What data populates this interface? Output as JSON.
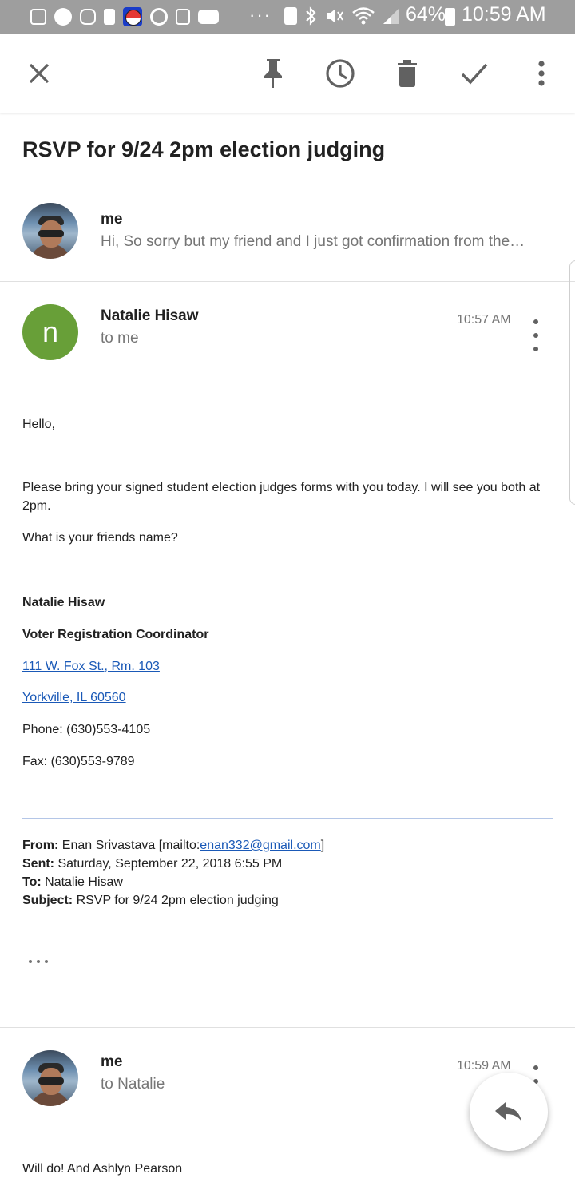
{
  "status_bar": {
    "battery": "64%",
    "time": "10:59 AM",
    "icons": [
      "messages-icon",
      "chat-bubble-icon",
      "instagram-icon",
      "lock-icon",
      "pokemon-go-icon",
      "threads-icon",
      "sim-icon",
      "youtube-icon",
      "more-notifications-icon",
      "recycle-icon",
      "bluetooth-icon",
      "mute-icon",
      "wifi-icon",
      "signal-icon",
      "battery-icon"
    ],
    "more": "···"
  },
  "toolbar": {
    "close_icon": "close-icon",
    "pin_icon": "pin-icon",
    "snooze_icon": "clock-icon",
    "delete_icon": "trash-icon",
    "done_icon": "check-icon",
    "more_icon": "more-vert-icon"
  },
  "thread": {
    "subject": "RSVP for 9/24 2pm election judging",
    "collapsed_message": {
      "sender": "me",
      "snippet": "Hi, So sorry but my friend and I just got confirmation from the…"
    },
    "expanded_message": {
      "avatar_letter": "n",
      "avatar_color": "#689f38",
      "sender": "Natalie Hisaw",
      "recipients": "to me",
      "time": "10:57 AM",
      "greeting": "Hello,",
      "paragraph1": "Please bring your signed student election judges forms with you today. I will see you both at 2pm.",
      "paragraph2": "What is your friends name?",
      "signature": {
        "name": "Natalie Hisaw",
        "title": "Voter Registration Coordinator",
        "address1": "111 W. Fox St., Rm. 103",
        "address2": "Yorkville, IL 60560",
        "phone": "Phone: (630)553-4105",
        "fax": "Fax: (630)553-9789"
      },
      "quoted": {
        "from_label": "From:",
        "from_value": " Enan Srivastava [mailto:",
        "from_email": "enan332@gmail.com",
        "from_close": "]",
        "sent_label": "Sent:",
        "sent_value": " Saturday, September 22, 2018 6:55 PM",
        "to_label": "To:",
        "to_value": " Natalie Hisaw",
        "subject_label": "Subject:",
        "subject_value": " RSVP for 9/24 2pm election judging"
      },
      "show_trimmed": "•••"
    },
    "reply_message": {
      "sender": "me",
      "recipients": "to Natalie",
      "time": "10:59 AM",
      "body": "Will do! And Ashlyn Pearson"
    }
  },
  "fab": {
    "icon": "reply-icon"
  },
  "colors": {
    "link": "#1a59b7",
    "status_bar": "#9e9e9e",
    "quote_rule": "#b4c6e7"
  }
}
